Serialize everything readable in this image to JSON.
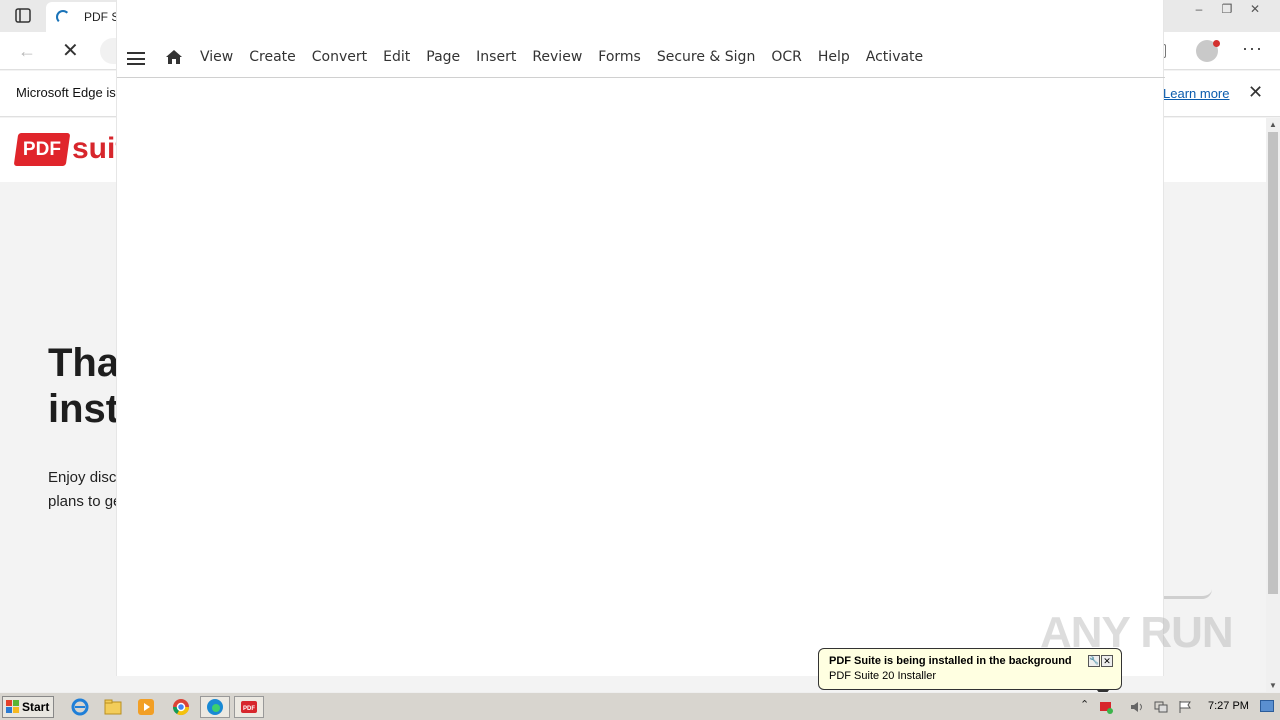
{
  "browser": {
    "tab_title": "PDF Su",
    "infobar_text": "Microsoft Edge is",
    "infobar_link": "Learn more",
    "back_icon": "←",
    "stop_icon": "✕",
    "close_icon": "✕",
    "more_icon": "···",
    "minimize_icon": "–",
    "restore_icon": "❐",
    "win_close_icon": "✕"
  },
  "website": {
    "logo_badge": "PDF",
    "logo_word": "suit",
    "hero_title": "Tha\ninst",
    "hero_subtitle": "Enjoy disc\nplans to ge"
  },
  "pdf_app": {
    "menu": [
      "View",
      "Create",
      "Convert",
      "Edit",
      "Page",
      "Insert",
      "Review",
      "Forms",
      "Secure & Sign",
      "OCR",
      "Help",
      "Activate"
    ]
  },
  "taskbar": {
    "start_label": "Start",
    "clock": "7:27 PM",
    "tray_up": "⌃"
  },
  "balloon": {
    "title": "PDF Suite is being installed in the background",
    "text": "PDF Suite 20 Installer",
    "close": "✕",
    "options": "🔧"
  },
  "watermark": "ANY RUN",
  "colors": {
    "brand_red": "#e0252b",
    "link_blue": "#0b5cad",
    "balloon_bg": "#ffffe1"
  }
}
